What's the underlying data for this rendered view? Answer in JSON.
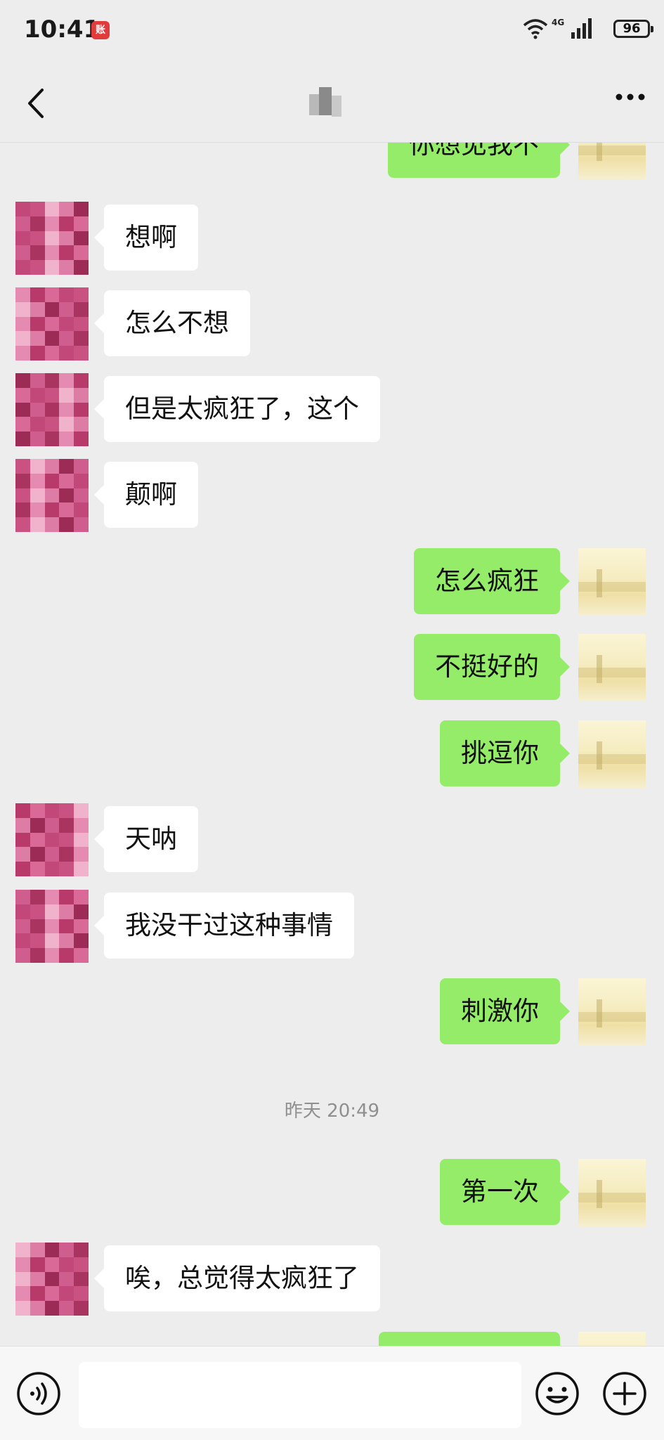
{
  "status_bar": {
    "time": "10:41",
    "app_badge": "账",
    "network": "4G",
    "battery": "96"
  },
  "nav": {
    "back_icon": "chevron-left-icon",
    "title": "",
    "more_icon": "more-dots-icon"
  },
  "messages": [
    {
      "side": "out",
      "text": "你想见我不"
    },
    {
      "side": "in",
      "text": "想啊"
    },
    {
      "side": "in",
      "text": "怎么不想"
    },
    {
      "side": "in",
      "text": "但是太疯狂了，这个"
    },
    {
      "side": "in",
      "text": "颠啊"
    },
    {
      "side": "out",
      "text": "怎么疯狂"
    },
    {
      "side": "out",
      "text": "不挺好的"
    },
    {
      "side": "out",
      "text": "挑逗你"
    },
    {
      "side": "in",
      "text": "天呐"
    },
    {
      "side": "in",
      "text": "我没干过这种事情"
    },
    {
      "side": "out",
      "text": "刺激你"
    },
    {
      "side": "out",
      "text": "第一次"
    },
    {
      "side": "in",
      "text": "唉，总觉得太疯狂了"
    },
    {
      "side": "out",
      "text": ""
    }
  ],
  "timestamp": "昨天 20:49",
  "input": {
    "voice_icon": "voice-icon",
    "text_value": "",
    "emoji_icon": "emoji-icon",
    "plus_icon": "plus-circle-icon"
  },
  "colors": {
    "background": "#ededed",
    "outgoing_bubble": "#95ec69",
    "incoming_bubble": "#ffffff",
    "timestamp_text": "#8f8f8f"
  }
}
